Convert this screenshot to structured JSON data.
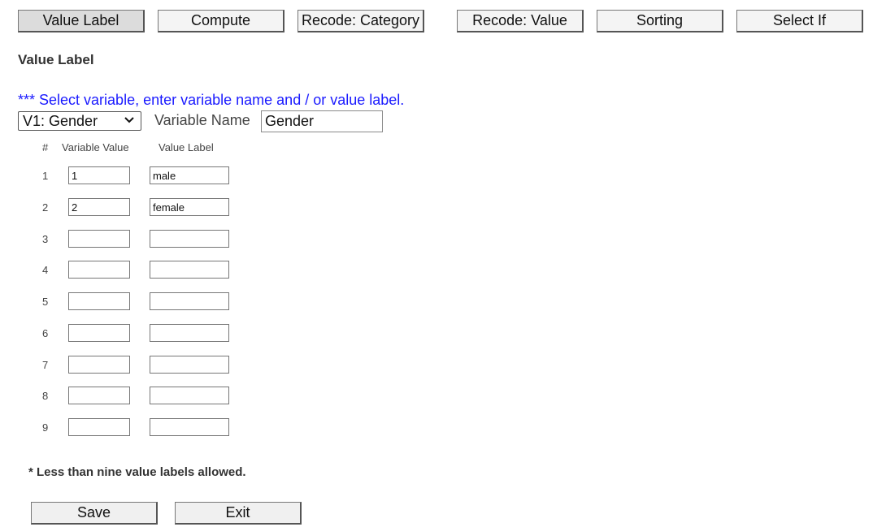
{
  "tabs": [
    {
      "label": "Value Label",
      "active": true
    },
    {
      "label": "Compute",
      "active": false
    },
    {
      "label": "Recode: Category",
      "active": false
    },
    {
      "label": "Recode: Value",
      "active": false
    },
    {
      "label": "Sorting",
      "active": false
    },
    {
      "label": "Select If",
      "active": false
    }
  ],
  "section_title": "Value Label",
  "instruction": "*** Select variable, enter variable name and / or value label.",
  "variable_select": {
    "selected": "V1: Gender"
  },
  "variable_name": {
    "label": "Variable Name",
    "value": "Gender"
  },
  "table": {
    "headers": {
      "num": "#",
      "value": "Variable Value",
      "label": "Value Label"
    },
    "rows": [
      {
        "num": "1",
        "value": "1",
        "label": "male"
      },
      {
        "num": "2",
        "value": "2",
        "label": "female"
      },
      {
        "num": "3",
        "value": "",
        "label": ""
      },
      {
        "num": "4",
        "value": "",
        "label": ""
      },
      {
        "num": "5",
        "value": "",
        "label": ""
      },
      {
        "num": "6",
        "value": "",
        "label": ""
      },
      {
        "num": "7",
        "value": "",
        "label": ""
      },
      {
        "num": "8",
        "value": "",
        "label": ""
      },
      {
        "num": "9",
        "value": "",
        "label": ""
      }
    ]
  },
  "note": "* Less than nine value labels allowed.",
  "buttons": {
    "save": "Save",
    "exit": "Exit"
  },
  "colors": {
    "instruction": "#1a1aff",
    "active_tab": "#dcdcdc"
  }
}
